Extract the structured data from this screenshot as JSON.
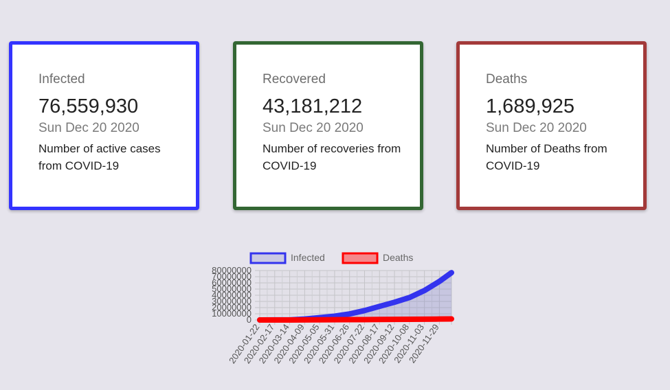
{
  "cards": [
    {
      "label": "Infected",
      "value": "76,559,930",
      "date": "Sun Dec 20 2020",
      "description": "Number of active cases from COVID-19",
      "color": "#3333ff"
    },
    {
      "label": "Recovered",
      "value": "43,181,212",
      "date": "Sun Dec 20 2020",
      "description": "Number of recoveries from COVID-19",
      "color": "#336633"
    },
    {
      "label": "Deaths",
      "value": "1,689,925",
      "date": "Sun Dec 20 2020",
      "description": "Number of Deaths from COVID-19",
      "color": "#a33a3a"
    }
  ],
  "chart_data": {
    "type": "line",
    "legend": {
      "position": "top"
    },
    "grid": true,
    "ylim": [
      0,
      80000000
    ],
    "y_ticks": [
      "80000000",
      "70000000",
      "60000000",
      "50000000",
      "40000000",
      "30000000",
      "20000000",
      "10000000",
      "0"
    ],
    "x_ticks": [
      "2020-01-22",
      "2020-02-17",
      "2020-03-14",
      "2020-04-09",
      "2020-05-05",
      "2020-05-31",
      "2020-06-26",
      "2020-07-22",
      "2020-08-17",
      "2020-09-12",
      "2020-10-08",
      "2020-11-03",
      "2020-11-29"
    ],
    "x": [
      "2020-01-22",
      "2020-02-17",
      "2020-03-14",
      "2020-04-09",
      "2020-05-05",
      "2020-05-31",
      "2020-06-26",
      "2020-07-22",
      "2020-08-17",
      "2020-09-12",
      "2020-10-08",
      "2020-11-03",
      "2020-11-29",
      "2020-12-20"
    ],
    "series": [
      {
        "name": "Infected",
        "color": "#3333ee",
        "fill": "rgba(120,120,200,0.25)",
        "values": [
          600,
          75000,
          150000,
          1500000,
          3700000,
          6200000,
          9800000,
          15200000,
          22000000,
          28700000,
          36300000,
          47600000,
          62400000,
          76559930
        ]
      },
      {
        "name": "Deaths",
        "color": "#ff0000",
        "fill": "rgba(255,60,60,0.55)",
        "values": [
          17,
          2000,
          6000,
          95000,
          260000,
          370000,
          495000,
          620000,
          780000,
          920000,
          1060000,
          1210000,
          1460000,
          1689925
        ]
      }
    ]
  }
}
